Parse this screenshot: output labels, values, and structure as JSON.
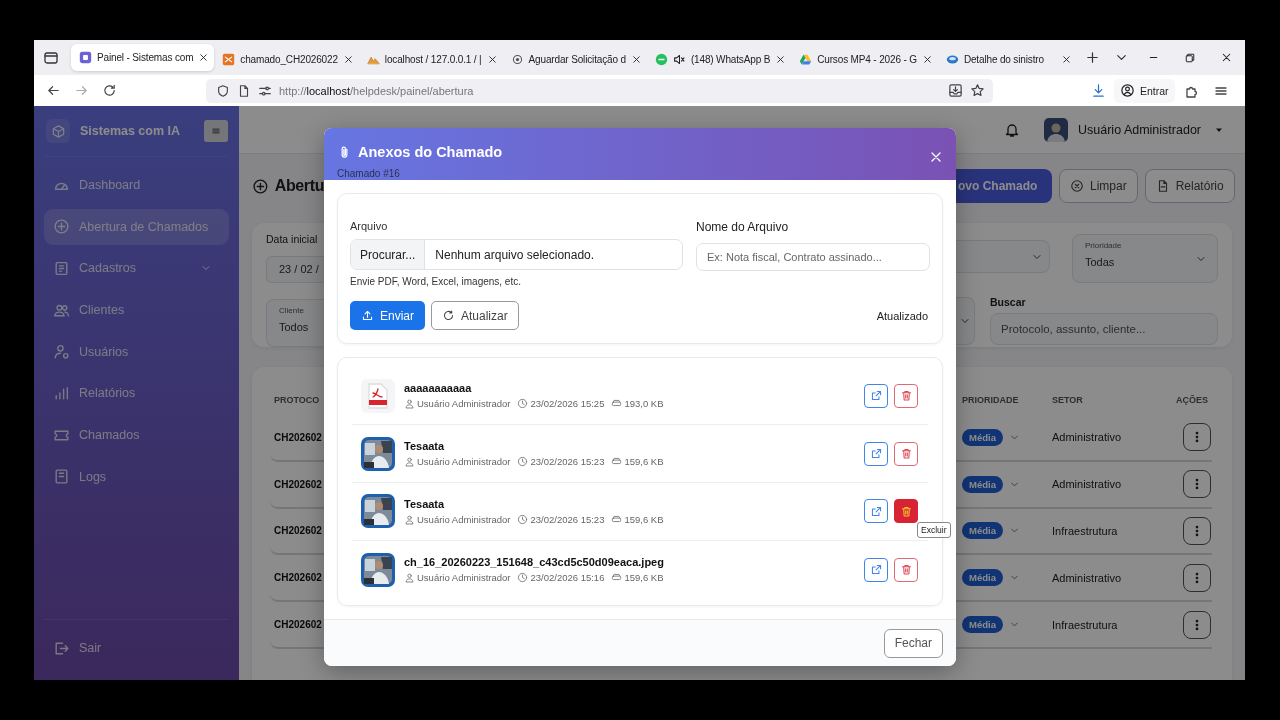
{
  "browser": {
    "tabs": [
      {
        "title": "Painel - Sistemas com",
        "selected": true,
        "muted": false
      },
      {
        "title": "chamado_CH2026022",
        "selected": false,
        "muted": false
      },
      {
        "title": "localhost / 127.0.0.1 / |",
        "selected": false,
        "muted": false
      },
      {
        "title": "Aguardar Solicitação d",
        "selected": false,
        "muted": false
      },
      {
        "title": "(148) WhatsApp B",
        "selected": false,
        "muted": true
      },
      {
        "title": "Cursos MP4 - 2026 - G",
        "selected": false,
        "muted": false
      },
      {
        "title": "Detalhe do sinistro",
        "selected": false,
        "muted": false
      }
    ],
    "url": "http://**localhost**/helpdesk/painel/abertura",
    "account_button": "Entrar"
  },
  "sidebar": {
    "brand": "Sistemas com IA",
    "items": [
      {
        "label": "Dashboard",
        "selected": false,
        "expandable": false
      },
      {
        "label": "Abertura de Chamados",
        "selected": true,
        "expandable": false
      },
      {
        "label": "Cadastros",
        "selected": false,
        "expandable": true
      },
      {
        "label": "Clientes",
        "selected": false,
        "expandable": false
      },
      {
        "label": "Usuários",
        "selected": false,
        "expandable": false
      },
      {
        "label": "Relatórios",
        "selected": false,
        "expandable": false
      },
      {
        "label": "Chamados",
        "selected": false,
        "expandable": false
      },
      {
        "label": "Logs",
        "selected": false,
        "expandable": false
      }
    ],
    "logout": "Sair"
  },
  "topbar": {
    "user": "Usuário Administrador"
  },
  "page": {
    "title": "Abertu",
    "buttons": [
      {
        "label": "ovo Chamado",
        "kind": "primary"
      },
      {
        "label": "Limpar",
        "kind": "clear"
      },
      {
        "label": "Relatório",
        "kind": "report"
      }
    ]
  },
  "filters": {
    "start_date": {
      "label": "Data inicial",
      "value": "23 / 02 /"
    },
    "client": {
      "label": "Cliente",
      "value": "Todos"
    },
    "priority": {
      "label": "Prioridade",
      "value": "Todas"
    },
    "search": {
      "label": "Buscar",
      "placeholder": "Protocolo, assunto, cliente..."
    }
  },
  "table": {
    "columns": [
      "PROTOCO",
      "PRIORIDADE",
      "SETOR",
      "AÇÕES"
    ],
    "rows": [
      {
        "protocol": "CH202602",
        "priority": "Média",
        "sector": "Administrativo"
      },
      {
        "protocol": "CH202602",
        "priority": "Média",
        "sector": "Administrativo"
      },
      {
        "protocol": "CH202602",
        "priority": "Média",
        "sector": "Infraestrutura"
      },
      {
        "protocol": "CH202602",
        "priority": "Média",
        "sector": "Administrativo"
      },
      {
        "protocol": "CH202602",
        "priority": "Média",
        "sector": "Infraestrutura"
      }
    ]
  },
  "modal": {
    "title": "Anexos do Chamado",
    "subtitle": "Chamado #16",
    "upload": {
      "file_label": "Arquivo",
      "browse_button": "Procurar...",
      "file_status": "Nenhum arquivo selecionado.",
      "hint": "Envie PDF, Word, Excel, imagens, etc.",
      "name_label": "Nome do Arquivo",
      "name_placeholder": "Ex: Nota fiscal, Contrato assinado...",
      "send_button": "Enviar",
      "refresh_button": "Atualizar",
      "status": "Atualizado"
    },
    "attachments": [
      {
        "kind": "pdf",
        "name": "aaaaaaaaaaa",
        "user": "Usuário Administrador",
        "date": "23/02/2026 15:25",
        "size": "193,0 KB",
        "delete_highlighted": false
      },
      {
        "name": "Tesaata",
        "user": "Usuário Administrador",
        "date": "23/02/2026 15:23",
        "size": "159,6 KB",
        "delete_highlighted": false
      },
      {
        "name": "Tesaata",
        "user": "Usuário Administrador",
        "date": "23/02/2026 15:23",
        "size": "159,6 KB",
        "delete_highlighted": true,
        "tooltip": "Excluir"
      },
      {
        "name": "ch_16_20260223_151648_c43cd5c50d09eaca.jpeg",
        "user": "Usuário Administrador",
        "date": "23/02/2026 15:16",
        "size": "159,6 KB",
        "delete_highlighted": false
      }
    ],
    "close_button": "Fechar"
  }
}
